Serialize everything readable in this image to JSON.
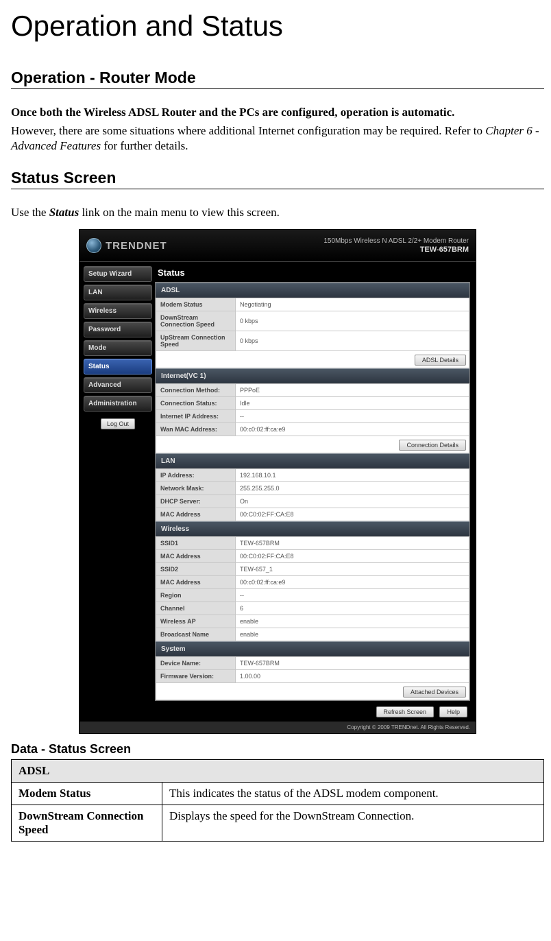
{
  "page": {
    "title": "Operation and Status",
    "section1": "Operation - Router Mode",
    "intro_bold": "Once both the Wireless ADSL Router and the PCs are configured, operation is automatic.",
    "intro_pre": "However, there are some situations where additional Internet configuration may be required. Refer to ",
    "intro_ital": "Chapter 6 - Advanced Features",
    "intro_post": " for further details.",
    "section2": "Status Screen",
    "lead_pre": "Use the ",
    "lead_bi": "Status",
    "lead_post": " link on the main menu to view this screen.",
    "subhead": "Data - Status Screen"
  },
  "router": {
    "brand": "TRENDNET",
    "tagline_top": "150Mbps Wireless N ADSL 2/2+ Modem Router",
    "tagline_model": "TEW-657BRM",
    "nav": {
      "items": [
        "Setup Wizard",
        "LAN",
        "Wireless",
        "Password",
        "Mode",
        "Status",
        "Advanced",
        "Administration"
      ],
      "active_index": 5,
      "logout": "Log Out"
    },
    "content_title": "Status",
    "adsl": {
      "header": "ADSL",
      "rows": [
        {
          "k": "Modem Status",
          "v": "Negotiating"
        },
        {
          "k": "DownStream Connection Speed",
          "v": "0 kbps"
        },
        {
          "k": "UpStream Connection Speed",
          "v": "0 kbps"
        }
      ],
      "button": "ADSL Details"
    },
    "internet": {
      "header": "Internet(VC 1)",
      "rows": [
        {
          "k": "Connection Method:",
          "v": "PPPoE"
        },
        {
          "k": "Connection Status:",
          "v": "Idle"
        },
        {
          "k": "Internet IP Address:",
          "v": "--"
        },
        {
          "k": "Wan MAC Address:",
          "v": "00:c0:02:ff:ca:e9"
        }
      ],
      "button": "Connection Details"
    },
    "lan": {
      "header": "LAN",
      "rows": [
        {
          "k": "IP Address:",
          "v": "192.168.10.1"
        },
        {
          "k": "Network Mask:",
          "v": "255.255.255.0"
        },
        {
          "k": "DHCP Server:",
          "v": "On"
        },
        {
          "k": "MAC Address",
          "v": "00:C0:02:FF:CA:E8"
        }
      ]
    },
    "wireless": {
      "header": "Wireless",
      "rows": [
        {
          "k": "SSID1",
          "v": "TEW-657BRM"
        },
        {
          "k": "MAC Address",
          "v": "00:C0:02:FF:CA:E8"
        },
        {
          "k": "SSID2",
          "v": "TEW-657_1"
        },
        {
          "k": "MAC Address",
          "v": "00:c0:02:ff:ca:e9"
        },
        {
          "k": "Region",
          "v": "--"
        },
        {
          "k": "Channel",
          "v": "6"
        },
        {
          "k": "Wireless AP",
          "v": "enable"
        },
        {
          "k": "Broadcast Name",
          "v": "enable"
        }
      ]
    },
    "system": {
      "header": "System",
      "rows": [
        {
          "k": "Device Name:",
          "v": "TEW-657BRM"
        },
        {
          "k": "Firmware Version:",
          "v": "1.00.00"
        }
      ],
      "button": "Attached Devices"
    },
    "bottom_buttons": {
      "refresh": "Refresh Screen",
      "help": "Help"
    },
    "footer": "Copyright © 2009 TRENDnet. All Rights Reserved."
  },
  "doc_table": {
    "section": "ADSL",
    "rows": [
      {
        "label": "Modem Status",
        "desc": "This indicates the status of the ADSL modem component."
      },
      {
        "label": "DownStream Connection Speed",
        "desc": "Displays the speed for the DownStream Connection."
      }
    ]
  }
}
